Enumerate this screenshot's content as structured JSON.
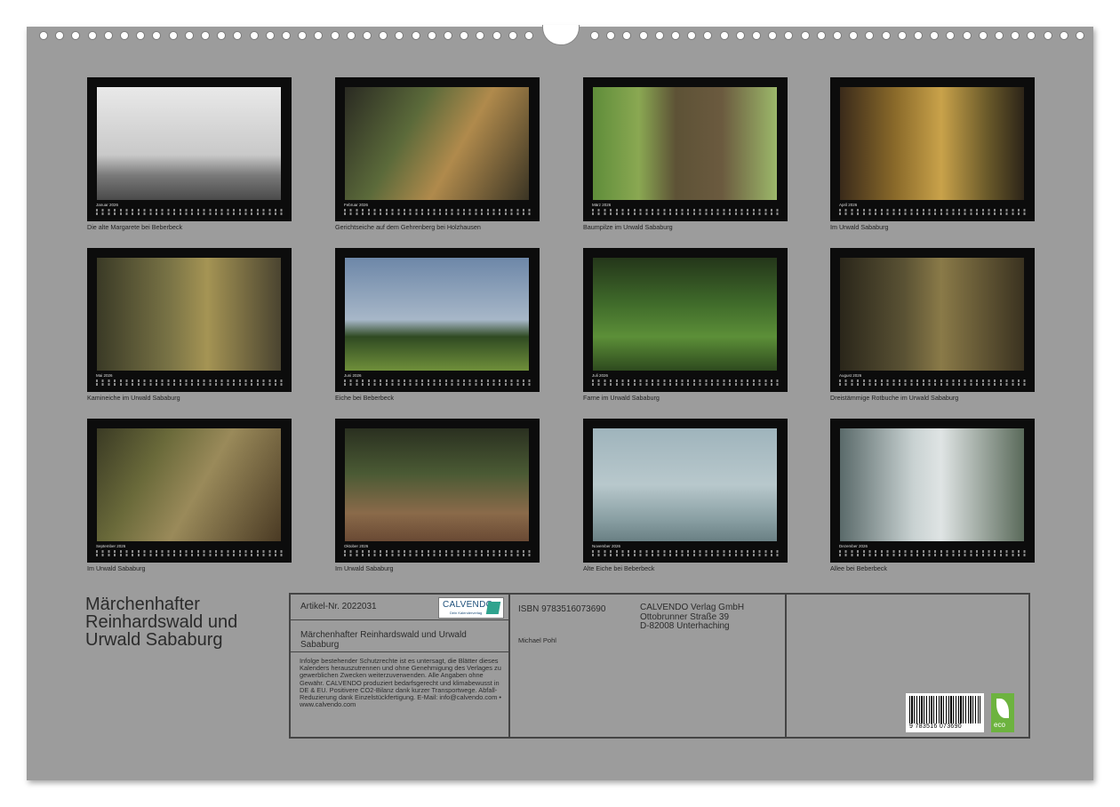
{
  "colors": {
    "page": "#9c9c9c",
    "tile": "#0c0c0c",
    "text": "#2b2b2b"
  },
  "months": [
    {
      "name": "Januar 2026",
      "caption": "Die alte Margarete bei Beberbeck",
      "scene": "fog"
    },
    {
      "name": "Februar 2026",
      "caption": "Gerichtseiche auf dem Gehrenberg bei Holzhausen",
      "scene": "forest-warm"
    },
    {
      "name": "März 2026",
      "caption": "Baumpilze im Urwald Sababurg",
      "scene": "trunk-green"
    },
    {
      "name": "April 2026",
      "caption": "Im Urwald Sababurg",
      "scene": "forest-autumn"
    },
    {
      "name": "Mai 2026",
      "caption": "Kamineiche im Urwald Sababurg",
      "scene": "forest-olive"
    },
    {
      "name": "Juni 2026",
      "caption": "Eiche bei Beberbeck",
      "scene": "sky-tree"
    },
    {
      "name": "Juli 2026",
      "caption": "Farne im Urwald Sababurg",
      "scene": "ferns"
    },
    {
      "name": "August 2026",
      "caption": "Dreistämmige Rotbuche im Urwald Sababurg",
      "scene": "forest-brown"
    },
    {
      "name": "September 2026",
      "caption": "Im Urwald Sababurg",
      "scene": "roots"
    },
    {
      "name": "Oktober 2026",
      "caption": "Im Urwald Sababurg",
      "scene": "forest-floor"
    },
    {
      "name": "November 2026",
      "caption": "Alte Eiche bei Beberbeck",
      "scene": "fog-blue"
    },
    {
      "name": "Dezember 2026",
      "caption": "Allee bei Beberbeck",
      "scene": "alley"
    }
  ],
  "cover": {
    "title": "Märchenhafter Reinhardswald und Urwald Sababurg"
  },
  "info": {
    "article": "Artikel-Nr. 2022031",
    "logo_text": "CALVENDO",
    "logo_sub": "Dein Kalenderverlag",
    "product_title": "Märchenhafter Reinhardswald und Urwald Sababurg",
    "isbn": "ISBN 9783516073690",
    "author": "Michael Pohl",
    "publisher": [
      "CALVENDO Verlag GmbH",
      "Ottobrunner Straße 39",
      "D-82008 Unterhaching"
    ],
    "legal": "Infolge bestehender Schutzrechte ist es untersagt, die Blätter dieses Kalenders herauszutrennen und ohne Genehmigung des Verlages zu gewerblichen Zwecken weiterzuverwenden. Alle Angaben ohne Gewähr. CALVENDO produziert bedarfsgerecht und klimabewusst in DE & EU. Positivere CO2-Bilanz dank kurzer Transportwege. Abfall-Reduzierung dank Einzelstückfertigung. E-Mail: info@calvendo.com • www.calvendo.com",
    "barcode_number": "9 783516 073690",
    "eco_label": "eco"
  }
}
